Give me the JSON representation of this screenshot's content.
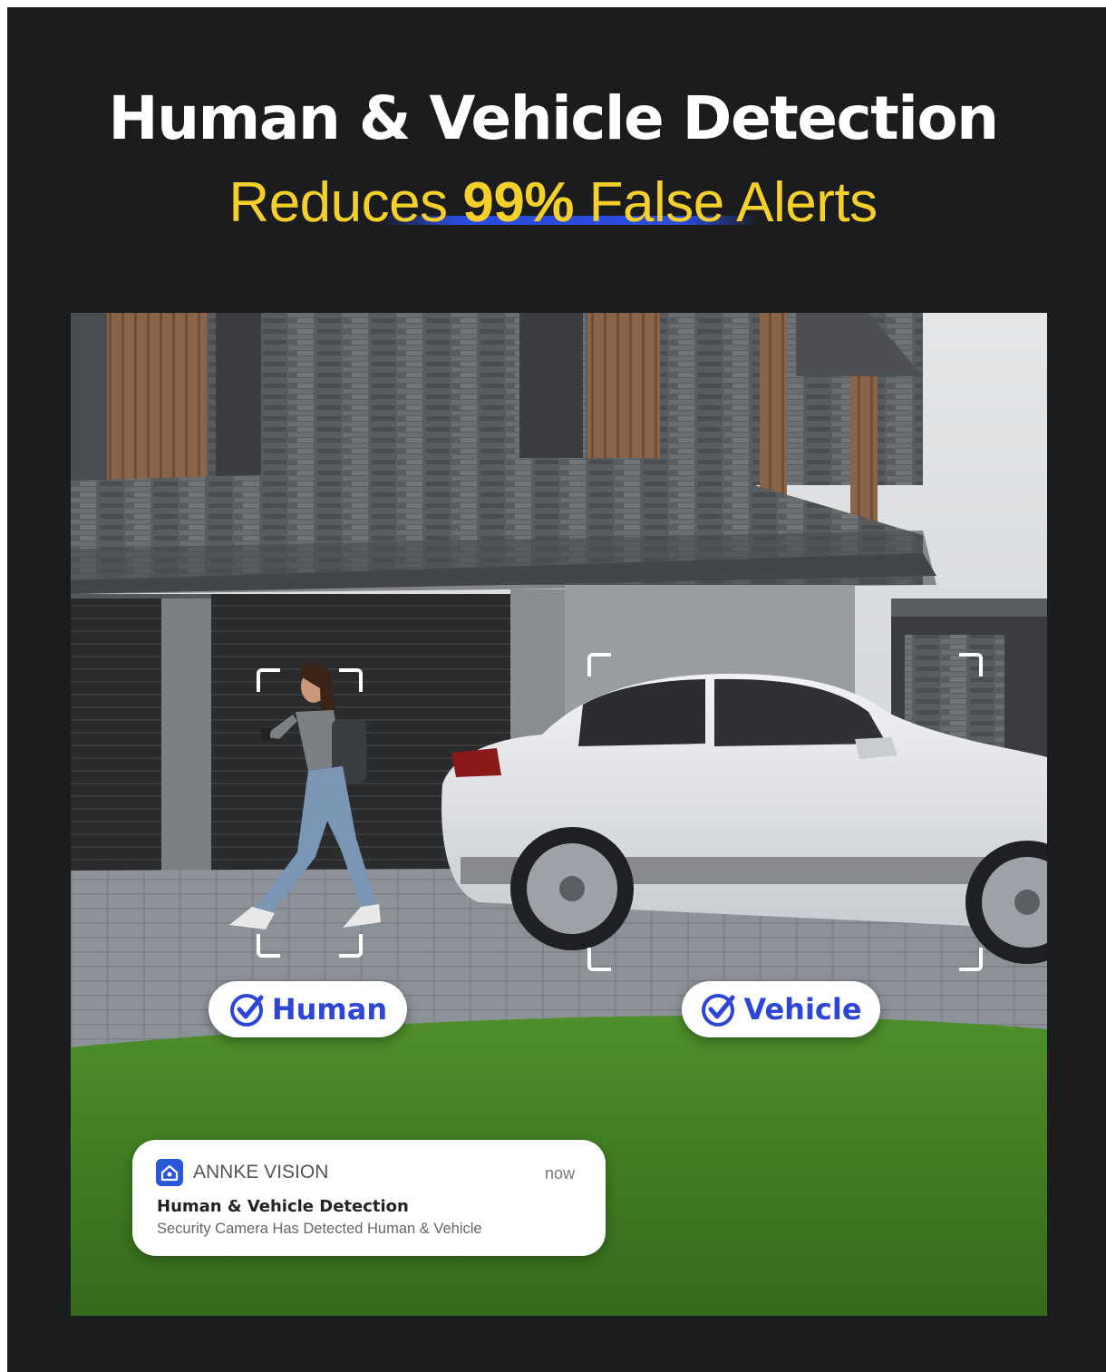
{
  "header": {
    "title": "Human & Vehicle Detection",
    "subtitle_before": "Reduces ",
    "subtitle_highlight": "99%",
    "subtitle_after": " False Alerts"
  },
  "labels": {
    "human": "Human",
    "vehicle": "Vehicle"
  },
  "notification": {
    "app_name": "ANNKE VISION",
    "time": "now",
    "title": "Human & Vehicle Detection",
    "body": "Security Camera Has Detected Human & Vehicle",
    "icon": "home-icon"
  },
  "colors": {
    "background": "#1b1c1e",
    "title": "#ffffff",
    "accent_yellow": "#f5cf2a",
    "accent_blue": "#2d46d6",
    "grass": "#4a8a2a"
  },
  "icons": {
    "check": "check-circle-icon"
  }
}
